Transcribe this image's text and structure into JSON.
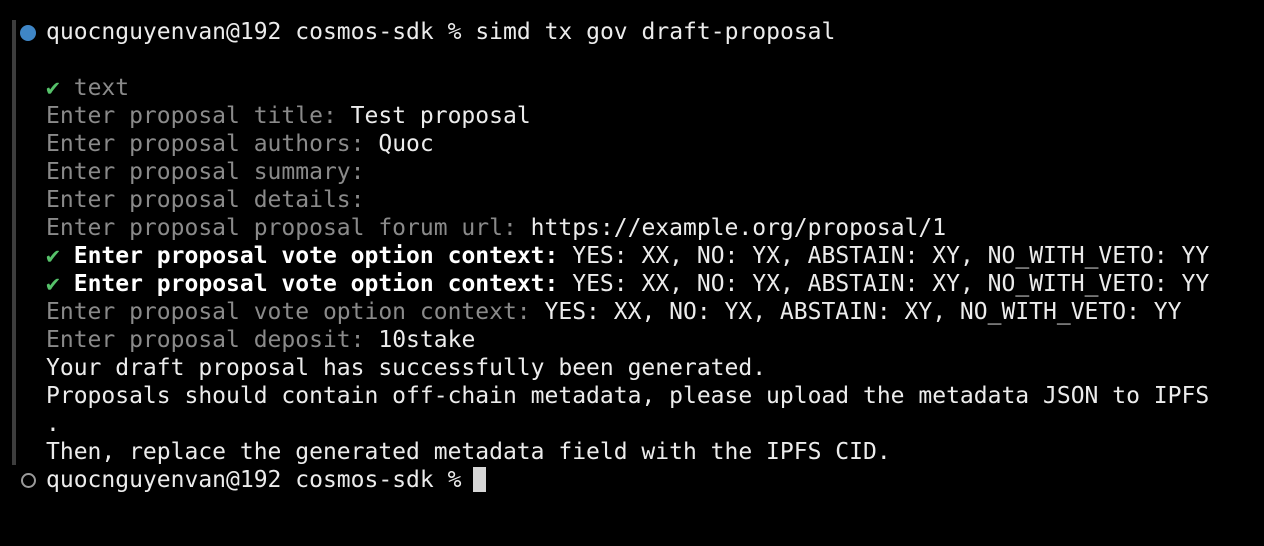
{
  "prompt": {
    "user_host": "quocnguyenvan@192",
    "dir": "cosmos-sdk",
    "symbol": "%"
  },
  "command": "simd tx gov draft-proposal",
  "check_mark": "✔",
  "selected_type": "text",
  "prompts": [
    {
      "label": "Enter proposal title:",
      "value": "Test proposal"
    },
    {
      "label": "Enter proposal authors:",
      "value": "Quoc"
    },
    {
      "label": "Enter proposal summary:",
      "value": ""
    },
    {
      "label": "Enter proposal details:",
      "value": ""
    },
    {
      "label": "Enter proposal proposal forum url:",
      "value": "https://example.org/proposal/1"
    },
    {
      "label": "Enter proposal vote option context:",
      "value": "YES: XX, NO: YX, ABSTAIN: XY, NO_WITH_VETO: YY"
    },
    {
      "label": "Enter proposal vote option context:",
      "value": "YES: XX, NO: YX, ABSTAIN: XY, NO_WITH_VETO: YY"
    },
    {
      "label": "Enter proposal vote option context:",
      "value": "YES: XX, NO: YX, ABSTAIN: XY, NO_WITH_VETO: YY"
    },
    {
      "label": "Enter proposal deposit:",
      "value": "10stake"
    }
  ],
  "messages": [
    "Your draft proposal has successfully been generated.",
    "Proposals should contain off-chain metadata, please upload the metadata JSON to IPFS",
    ".",
    "Then, replace the generated metadata field with the IPFS CID."
  ],
  "colors": {
    "background": "#000000",
    "text": "#ececec",
    "dim": "#8a8a8a",
    "check": "#56c26a",
    "status_dot": "#3f86c6"
  }
}
